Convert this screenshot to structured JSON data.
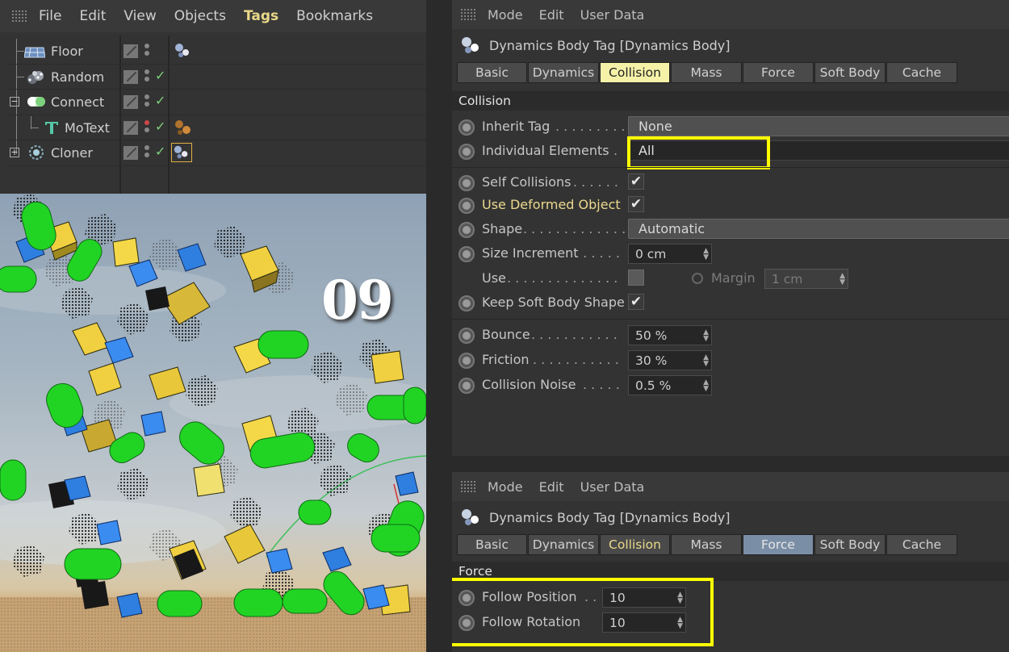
{
  "object_manager": {
    "menu": [
      "File",
      "Edit",
      "View",
      "Objects",
      "Tags",
      "Bookmarks"
    ],
    "objects": [
      {
        "name": "Floor",
        "icon": "floor-icon"
      },
      {
        "name": "Random",
        "icon": "random-effector-icon"
      },
      {
        "name": "Connect",
        "icon": "connect-icon"
      },
      {
        "name": "MoText",
        "icon": "motext-icon"
      },
      {
        "name": "Cloner",
        "icon": "cloner-icon"
      }
    ]
  },
  "viewport": {
    "label": "09"
  },
  "panel_top": {
    "menu": [
      "Mode",
      "Edit",
      "User Data"
    ],
    "tag_title": "Dynamics Body Tag [Dynamics Body]",
    "tabs": [
      "Basic",
      "Dynamics",
      "Collision",
      "Mass",
      "Force",
      "Soft Body",
      "Cache"
    ],
    "active_tab": "Collision",
    "section": "Collision",
    "params": {
      "inherit_tag": {
        "label": "Inherit Tag",
        "value": "None"
      },
      "individual_elements": {
        "label": "Individual Elements",
        "value": "All"
      },
      "self_collisions": {
        "label": "Self Collisions",
        "checked": "✔"
      },
      "use_deformed": {
        "label": "Use Deformed Object",
        "checked": "✔"
      },
      "shape": {
        "label": "Shape",
        "value": "Automatic"
      },
      "size_increment": {
        "label": "Size Increment",
        "value": "0 cm"
      },
      "use": {
        "label": "Use"
      },
      "margin": {
        "label": "Margin",
        "value": "1 cm"
      },
      "keep_soft_body_shape": {
        "label": "Keep Soft Body Shape",
        "checked": "✔"
      },
      "bounce": {
        "label": "Bounce",
        "value": "50 %"
      },
      "friction": {
        "label": "Friction",
        "value": "30 %"
      },
      "collision_noise": {
        "label": "Collision Noise",
        "value": "0.5 %"
      }
    }
  },
  "panel_bottom": {
    "menu": [
      "Mode",
      "Edit",
      "User Data"
    ],
    "tag_title": "Dynamics Body Tag [Dynamics Body]",
    "tabs": [
      "Basic",
      "Dynamics",
      "Collision",
      "Mass",
      "Force",
      "Soft Body",
      "Cache"
    ],
    "active_tab": "Force",
    "section": "Force",
    "params": {
      "follow_position": {
        "label": "Follow Position",
        "value": "10"
      },
      "follow_rotation": {
        "label": "Follow Rotation",
        "value": "10"
      }
    }
  },
  "colors": {
    "highlight": "#ffff00",
    "active_tab": "#f5f2a8",
    "active_tab_force": "#7a8ea6",
    "panel_bg": "#333333"
  }
}
